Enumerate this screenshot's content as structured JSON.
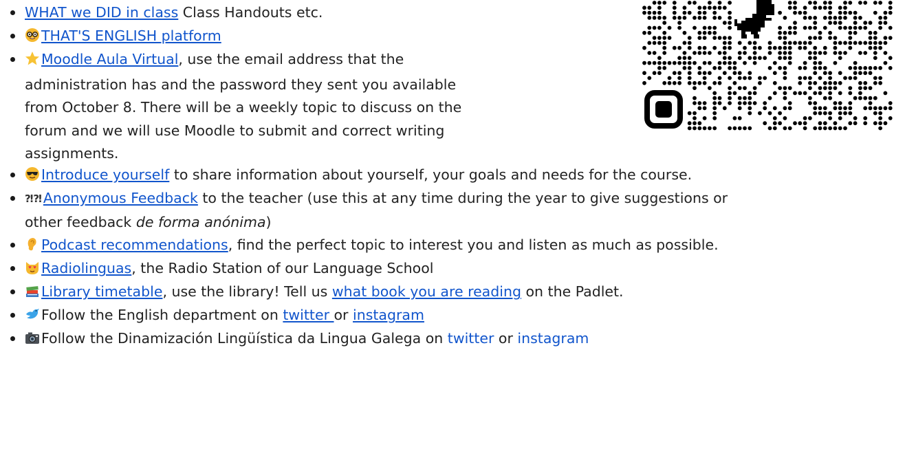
{
  "items": [
    {
      "link": "WHAT we DID in class",
      "after": " Class Handouts etc."
    },
    {
      "icon": "nerd-face-icon",
      "link": "THAT'S ENGLISH platform"
    },
    {
      "icon": "star-icon",
      "link": "Moodle Aula Virtual",
      "lines": [
        ", use the email address that the",
        "administration has and the password they sent you available",
        "from October 8. There will be a weekly topic to discuss on the",
        "forum and we will use Moodle to submit and correct writing",
        "assignments."
      ]
    },
    {
      "icon": "sunglasses-face-icon",
      "link": "Introduce yourself",
      "after": " to share information about yourself, your goals and needs for the course."
    },
    {
      "icon": "interrobang-icon",
      "link": "Anonymous Feedback",
      "after": " to the teacher (use this at any time during the year to give suggestions or",
      "line2_before": "other feedback ",
      "line2_italic": "de forma anónima",
      "line2_after": ")"
    },
    {
      "icon": "ear-icon",
      "link": "Podcast recommendations",
      "after": ", find the perfect topic to interest you and listen as much as possible."
    },
    {
      "icon": "heart-eyes-cat-icon",
      "link": "Radiolinguas",
      "after": ", the Radio Station of our Language School"
    },
    {
      "icon": "books-icon",
      "link": "Library timetable",
      "middle": ", use the library! Tell us ",
      "link2": "what book you are reading",
      "after": " on the Padlet."
    },
    {
      "icon": "bird-icon",
      "before": "Follow the English department on ",
      "link": "twitter ",
      "middle": "or ",
      "link2": "instagram"
    },
    {
      "icon": "camera-icon",
      "before": "Follow the Dinamización Lingüística da Lingua Galega on ",
      "link": "twitter",
      "middle": " or ",
      "link2": "instagram"
    }
  ],
  "colors": {
    "link": "#1155cc",
    "text": "#222222"
  }
}
